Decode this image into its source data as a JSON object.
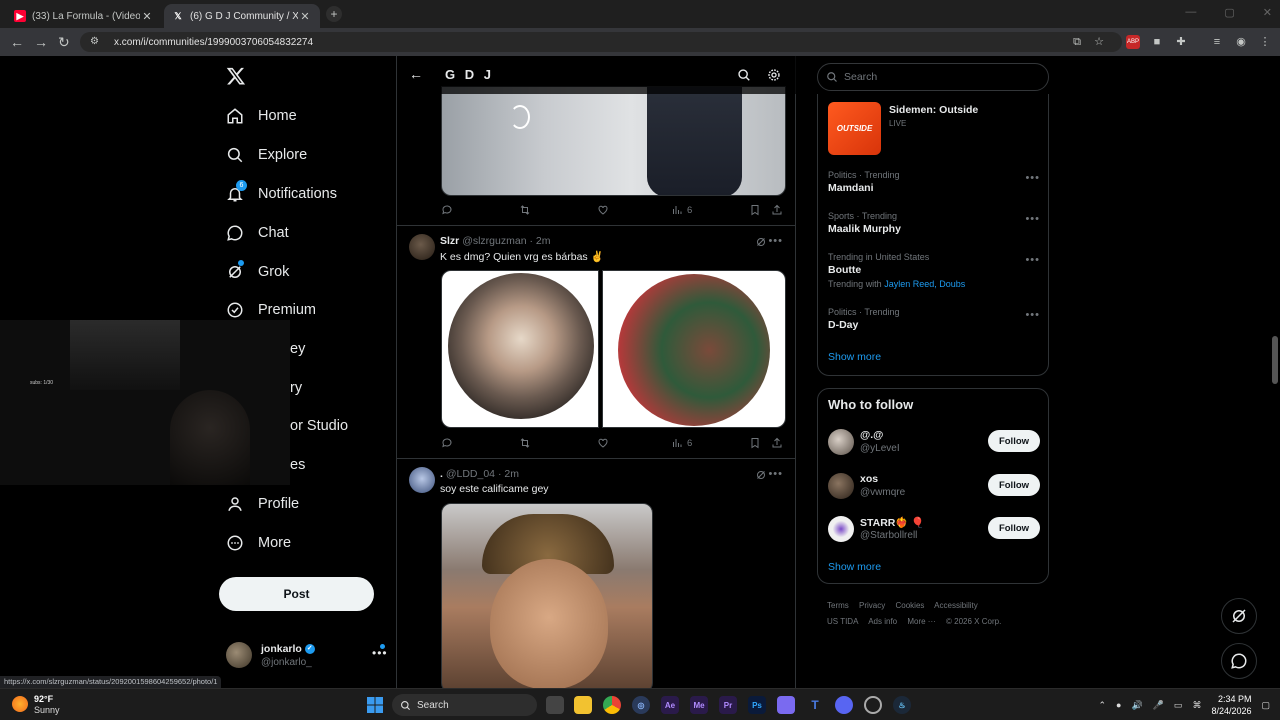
{
  "browser": {
    "tabs": [
      {
        "title": "(33) La Formula - (Video Oficia",
        "favicon": "youtube-icon",
        "color": "#ff0033"
      },
      {
        "title": "(6) G D J Community / X",
        "favicon": "x-icon",
        "color": "#ffffff"
      }
    ],
    "new_tab": "+",
    "url": "x.com/i/communities/1999003706054832274"
  },
  "nav": {
    "items": [
      {
        "label": "Home",
        "icon": "home-icon"
      },
      {
        "label": "Explore",
        "icon": "search-icon"
      },
      {
        "label": "Notifications",
        "icon": "bell-icon",
        "badge": "6"
      },
      {
        "label": "Chat",
        "icon": "chat-icon"
      },
      {
        "label": "Grok",
        "icon": "grok-icon"
      },
      {
        "label": "Premium",
        "icon": "verified-icon"
      },
      {
        "label": "ey",
        "icon": ""
      },
      {
        "label": "ry",
        "icon": ""
      },
      {
        "label": "or Studio",
        "icon": ""
      },
      {
        "label": "es",
        "icon": ""
      },
      {
        "label": "Profile",
        "icon": "profile-icon"
      },
      {
        "label": "More",
        "icon": "more-circle-icon"
      }
    ],
    "post_button": "Post",
    "account": {
      "name": "jonkarlo",
      "handle": "@jonkarlo_",
      "more": "•••"
    }
  },
  "webcam": {
    "overlay_text": "subs: 1/30"
  },
  "community": {
    "title": "G D J",
    "prev_post": {
      "views": "6"
    },
    "posts": [
      {
        "name": "Slzr",
        "handle": "@slzrguzman",
        "time": "2m",
        "text": "K es dmg? Quien vrg es bárbas ✌️",
        "views": "6"
      },
      {
        "name": ".",
        "handle": "@LDD_04",
        "time": "2m",
        "text": "soy este calificame gey"
      }
    ]
  },
  "sidebar": {
    "search_placeholder": "Search",
    "live": {
      "title": "Sidemen: Outside",
      "status": "LIVE",
      "thumb_text": "OUTSIDE"
    },
    "trends": [
      {
        "meta": "Politics · Trending",
        "title": "Mamdani"
      },
      {
        "meta": "Sports · Trending",
        "title": "Maalik Murphy"
      },
      {
        "meta": "Trending in United States",
        "title": "Boutte",
        "with_prefix": "Trending with ",
        "with": "Jaylen Reed, Doubs"
      },
      {
        "meta": "Politics · Trending",
        "title": "D-Day"
      }
    ],
    "show_more": "Show more",
    "who_to_follow": {
      "title": "Who to follow",
      "users": [
        {
          "name": "@.@",
          "handle": "@yLeveI",
          "follow": "Follow"
        },
        {
          "name": "xos",
          "handle": "@vwmqre",
          "follow": "Follow"
        },
        {
          "name": "STARR❤️‍🔥 🎈",
          "handle": "@Starbollrell",
          "follow": "Follow"
        }
      ],
      "show_more": "Show more"
    },
    "footer": [
      "Terms",
      "Privacy",
      "Cookies",
      "Accessibility",
      "US TIDA",
      "Ads info",
      "More ···",
      "© 2026 X Corp."
    ]
  },
  "status_url": "https://x.com/slzrguzman/status/2092001598604259652/photo/1",
  "taskbar": {
    "weather_temp": "92°F",
    "weather_cond": "Sunny",
    "search": "Search",
    "time": "2:34 PM",
    "date": "8/24/2026"
  }
}
